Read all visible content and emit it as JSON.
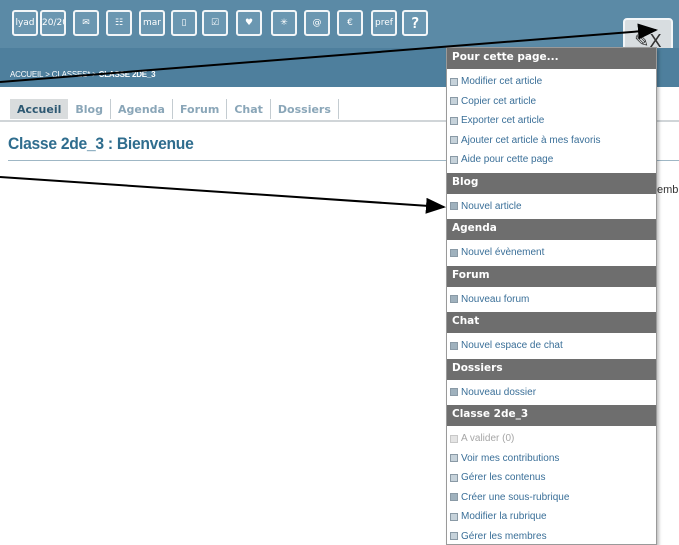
{
  "toolbar": {
    "icons": [
      {
        "name": "agenda-icon",
        "glyph": "lyad"
      },
      {
        "name": "grades-icon",
        "glyph": "20/20"
      },
      {
        "name": "mail-icon",
        "glyph": "✉"
      },
      {
        "name": "address-book-icon",
        "glyph": "☷"
      },
      {
        "name": "calendar-icon",
        "glyph": "mar 18"
      },
      {
        "name": "documents-icon",
        "glyph": "▯"
      },
      {
        "name": "clipboard-icon",
        "glyph": "☑"
      },
      {
        "name": "favorites-icon",
        "glyph": "♥"
      },
      {
        "name": "network-icon",
        "glyph": "✳"
      },
      {
        "name": "email-at-icon",
        "glyph": "@"
      },
      {
        "name": "payment-icon",
        "glyph": "€"
      },
      {
        "name": "profile-card-icon",
        "glyph": "pref"
      },
      {
        "name": "help-icon",
        "glyph": "?"
      }
    ],
    "admin_tools_glyph": "✎X"
  },
  "breadcrumb": {
    "items": [
      "ACCUEIL",
      "CLASSES*"
    ],
    "separator": ">",
    "current": "CLASSE 2DE_3"
  },
  "tabs": [
    "Accueil",
    "Blog",
    "Agenda",
    "Forum",
    "Chat",
    "Dossiers"
  ],
  "page_title": "Classe 2de_3 : Bienvenue",
  "background_text": "emb",
  "menu": {
    "sections": [
      {
        "title": "Pour cette page...",
        "items": [
          {
            "label": "Modifier cet article",
            "icon": "edit-icon",
            "enabled": true
          },
          {
            "label": "Copier cet article",
            "icon": "copy-icon",
            "enabled": true
          },
          {
            "label": "Exporter cet article",
            "icon": "export-icon",
            "enabled": true
          },
          {
            "label": "Ajouter cet article à mes favoris",
            "icon": "favorite-icon",
            "enabled": true
          },
          {
            "label": "Aide pour cette page",
            "icon": "help-small-icon",
            "enabled": true
          }
        ]
      },
      {
        "title": "Blog",
        "items": [
          {
            "label": "Nouvel article",
            "icon": "plus-icon",
            "enabled": true
          }
        ]
      },
      {
        "title": "Agenda",
        "items": [
          {
            "label": "Nouvel évènement",
            "icon": "plus-icon",
            "enabled": true
          }
        ]
      },
      {
        "title": "Forum",
        "items": [
          {
            "label": "Nouveau forum",
            "icon": "plus-icon",
            "enabled": true
          }
        ]
      },
      {
        "title": "Chat",
        "items": [
          {
            "label": "Nouvel espace de chat",
            "icon": "plus-icon",
            "enabled": true
          }
        ]
      },
      {
        "title": "Dossiers",
        "items": [
          {
            "label": "Nouveau dossier",
            "icon": "plus-icon",
            "enabled": true
          }
        ]
      },
      {
        "title": "Classe 2de_3",
        "items": [
          {
            "label": "A valider (0)",
            "icon": "validate-icon",
            "enabled": false
          },
          {
            "label": "Voir mes contributions",
            "icon": "contributions-icon",
            "enabled": true
          },
          {
            "label": "Gérer les contenus",
            "icon": "contents-icon",
            "enabled": true
          },
          {
            "label": "Créer une sous-rubrique",
            "icon": "plus-icon",
            "enabled": true
          },
          {
            "label": "Modifier la rubrique",
            "icon": "edit-icon",
            "enabled": true
          },
          {
            "label": "Gérer les membres",
            "icon": "members-icon",
            "enabled": true
          }
        ]
      }
    ]
  },
  "colors": {
    "toolbar": "#5b8aa6",
    "breadcrumb_band": "#4e7f9d",
    "menu_header": "#6e6e6e",
    "menu_link": "#3a6f98",
    "title": "#2f6d8e"
  }
}
